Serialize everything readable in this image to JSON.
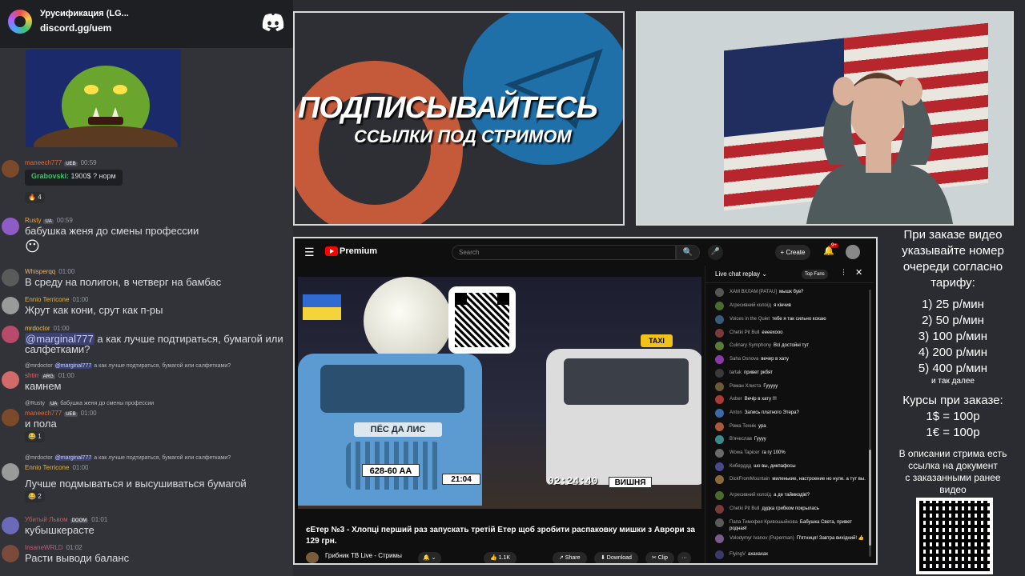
{
  "discord": {
    "server_name": "Урусификация (LG...",
    "invite": "discord.gg/uem",
    "messages": [
      {
        "user": "maneech777",
        "badges": [
          "UEB"
        ],
        "time": "00:59",
        "quote_name": "Grabovski:",
        "quote_text": "1900$ ? норм",
        "reaction": "4",
        "color": "#e06c3c"
      },
      {
        "user": "Rusty",
        "badges": [
          "UA"
        ],
        "time": "00:59",
        "text": "бабушка женя до смены профессии",
        "color": "#f2a73b"
      },
      {
        "user": "Whisperqq",
        "badges": [],
        "time": "01:00",
        "text": "В среду на полигон, в четверг на бамбас",
        "color": "#e8b65a"
      },
      {
        "user": "Ennio Terricone",
        "badges": [],
        "time": "01:00",
        "text": "Жрут как кони, срут как п-ры",
        "color": "#e3b443"
      },
      {
        "user": "mrdoctor",
        "badges": [],
        "time": "01:00",
        "mention": "@marginal777",
        "text": "а как лучше подтираться, бумагой или",
        "text2": "салфетками?",
        "color": "#e8c36a"
      },
      {
        "user": "shtirr",
        "badges": [
          "ARG"
        ],
        "time": "01:00",
        "reply_user": "@mrdoctor",
        "reply_mention": "@marginal777",
        "reply_text": "а как лучше подтираться, бумагой или салфетками?",
        "text": "камнем",
        "color": "#d36a6a"
      },
      {
        "user": "maneech777",
        "badges": [
          "UEB"
        ],
        "time": "01:00",
        "reply_user": "@Rusty",
        "reply_badge": "UA",
        "reply_text": "бабушка женя до смены профессии",
        "text": "и пола",
        "reaction": "1",
        "color": "#e06c3c"
      },
      {
        "user": "Ennio Terricone",
        "badges": [],
        "time": "01:00",
        "reply_user": "@mrdoctor",
        "reply_mention": "@marginal777",
        "reply_text": "а как лучше подтираться, бумагой или салфетками?",
        "text": "Лучше подмываться и высушиваться бумагой",
        "reaction": "2",
        "color": "#e3b443"
      },
      {
        "user": "Убитый Львом",
        "badges": [
          "DOOM"
        ],
        "time": "01:01",
        "text": "кубышкерасте",
        "color": "#c95e5e"
      },
      {
        "user": "InsaneWRLD",
        "badges": [],
        "time": "01:02",
        "text": "Расти выводи баланс",
        "color": "#c85a7a"
      }
    ]
  },
  "banner": {
    "line1": "ПОДПИСЫВАЙТЕСЬ",
    "line2": "ССЫЛКИ ПОД СТРИМОМ"
  },
  "youtube": {
    "menu_icon": "☰",
    "brand": "Premium",
    "search_placeholder": "Search",
    "search_icon": "🔍",
    "mic_icon": "🎤",
    "create_label": "+ Create",
    "bell_icon": "🔔",
    "notif_count": "9+",
    "thumbnail": {
      "truck_sign": "ПЁС ДА ЛИС",
      "plate_left": "628-60 AA",
      "plate_mid": "21:04",
      "taxi": "TAXI",
      "timer": "02:24:40",
      "plate_right": "ВИШНЯ"
    },
    "video_title": "єЕтер №3 - Хлопці перший раз запускать третій Етер щоб зробити распаковку мишки з Аврори за 129 грн.",
    "channel": "Грибник ТВ Live - Стримы",
    "actions": {
      "like": "👍 1.1K",
      "share": "↗ Share",
      "download": "⬇ Download",
      "clip": "✂ Clip",
      "more": "···"
    },
    "livechat": {
      "title": "Live chat replay ⌄",
      "top_fans": "Top Fans",
      "more_icon": "⋮",
      "close_icon": "✕",
      "rows": [
        {
          "name": "ХАМ ВХЛАМ [PATAU]",
          "text": "мышк був?",
          "color": "#555"
        },
        {
          "name": "Агресивний колоїд",
          "text": "я кінчив",
          "color": "#4b6a2e"
        },
        {
          "name": "Voices in the Quiet",
          "text": "тебе я так сильно кохаю",
          "color": "#3a5a7a"
        },
        {
          "name": "Chetki Pit Bull",
          "text": "еееехооо",
          "color": "#7a3a3a"
        },
        {
          "name": "Culinary Symphony",
          "text": "Всі достойні тут",
          "color": "#5a7a3a"
        },
        {
          "name": "Saha Osnova",
          "text": "вечер в хату",
          "color": "#8a3aa8"
        },
        {
          "name": "tartak",
          "text": "привет ркбят",
          "color": "#3a3a3a"
        },
        {
          "name": "Роман Хлиста",
          "text": "Гууууу",
          "color": "#6a5a3a"
        },
        {
          "name": "Axber",
          "text": "Вечір в хату !!!",
          "color": "#a83a3a"
        },
        {
          "name": "Anton",
          "text": "Запись платного Этера?",
          "color": "#3a6aa8"
        },
        {
          "name": "Рома Технік",
          "text": "ура",
          "color": "#a85a3a"
        },
        {
          "name": "В'ячеслав",
          "text": "Гуууу",
          "color": "#3a8a8a"
        },
        {
          "name": "Wowa Tapicer",
          "text": "га гу 100%",
          "color": "#6a6a6a"
        },
        {
          "name": "Киберддд",
          "text": "шо вы, дикпафосы",
          "color": "#4a4a8a"
        },
        {
          "name": "DickFromMountain",
          "text": "миленькие, настроение но нуле. а тут вы.",
          "color": "#8a6a3a"
        },
        {
          "name": "Агресивний колоїд",
          "text": "а де таймкодікі?",
          "color": "#4b6a2e"
        },
        {
          "name": "Chetki Pit Bull",
          "text": "дудка грибком покрылась",
          "color": "#7a3a3a"
        },
        {
          "name": "Папа Тимофея Кривошыйкова",
          "text": "Бабушка Света, привет родная!",
          "color": "#5a5a5a"
        },
        {
          "name": "Volodymyr Ivanov (Puperman)",
          "text": "П'ятниця! Завтра вихідний! 👍",
          "color": "#7a5a8a"
        },
        {
          "name": "FlyingV",
          "text": "ахахахах",
          "color": "#3a3a6a"
        }
      ]
    }
  },
  "info": {
    "heading": [
      "При заказе видео",
      "указывайте номер",
      "очереди согласно",
      "тарифу:"
    ],
    "tariffs": [
      "1) 25 р/мин",
      "2) 50 р/мин",
      "3) 100 р/мин",
      "4) 200 р/мин",
      "5) 400 р/мин"
    ],
    "and_so_on": "и так далее",
    "rates_title": "Курсы при заказе:",
    "rates": [
      "1$ = 100р",
      "1€ = 100р"
    ],
    "note": [
      "В описании стрима есть",
      "ссылка на документ",
      "с заказанными ранее",
      "видео"
    ]
  }
}
